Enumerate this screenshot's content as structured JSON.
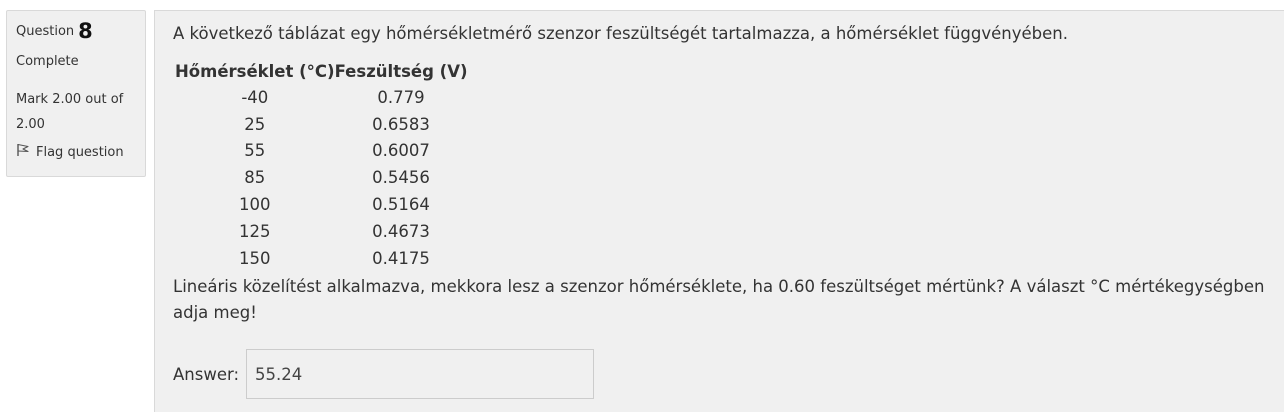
{
  "info": {
    "question_label": "Question",
    "question_number": "8",
    "state": "Complete",
    "grade": "Mark 2.00 out of 2.00",
    "flag_label": "Flag question"
  },
  "question": {
    "intro": "A következő táblázat egy hőmérsékletmérő szenzor feszültségét tartalmazza, a hőmérséklet függvényében.",
    "table": {
      "headers": [
        "Hőmérséklet (°C)",
        "Feszültség (V)"
      ],
      "rows": [
        [
          "-40",
          "0.779"
        ],
        [
          "25",
          "0.6583"
        ],
        [
          "55",
          "0.6007"
        ],
        [
          "85",
          "0.5456"
        ],
        [
          "100",
          "0.5164"
        ],
        [
          "125",
          "0.4673"
        ],
        [
          "150",
          "0.4175"
        ]
      ]
    },
    "text": "Lineáris közelítést alkalmazva, mekkora lesz a szenzor hőmérséklete, ha 0.60 feszültséget mértünk? A választ °C mértékegységben adja meg!"
  },
  "answer": {
    "label": "Answer:",
    "value": "55.24"
  }
}
